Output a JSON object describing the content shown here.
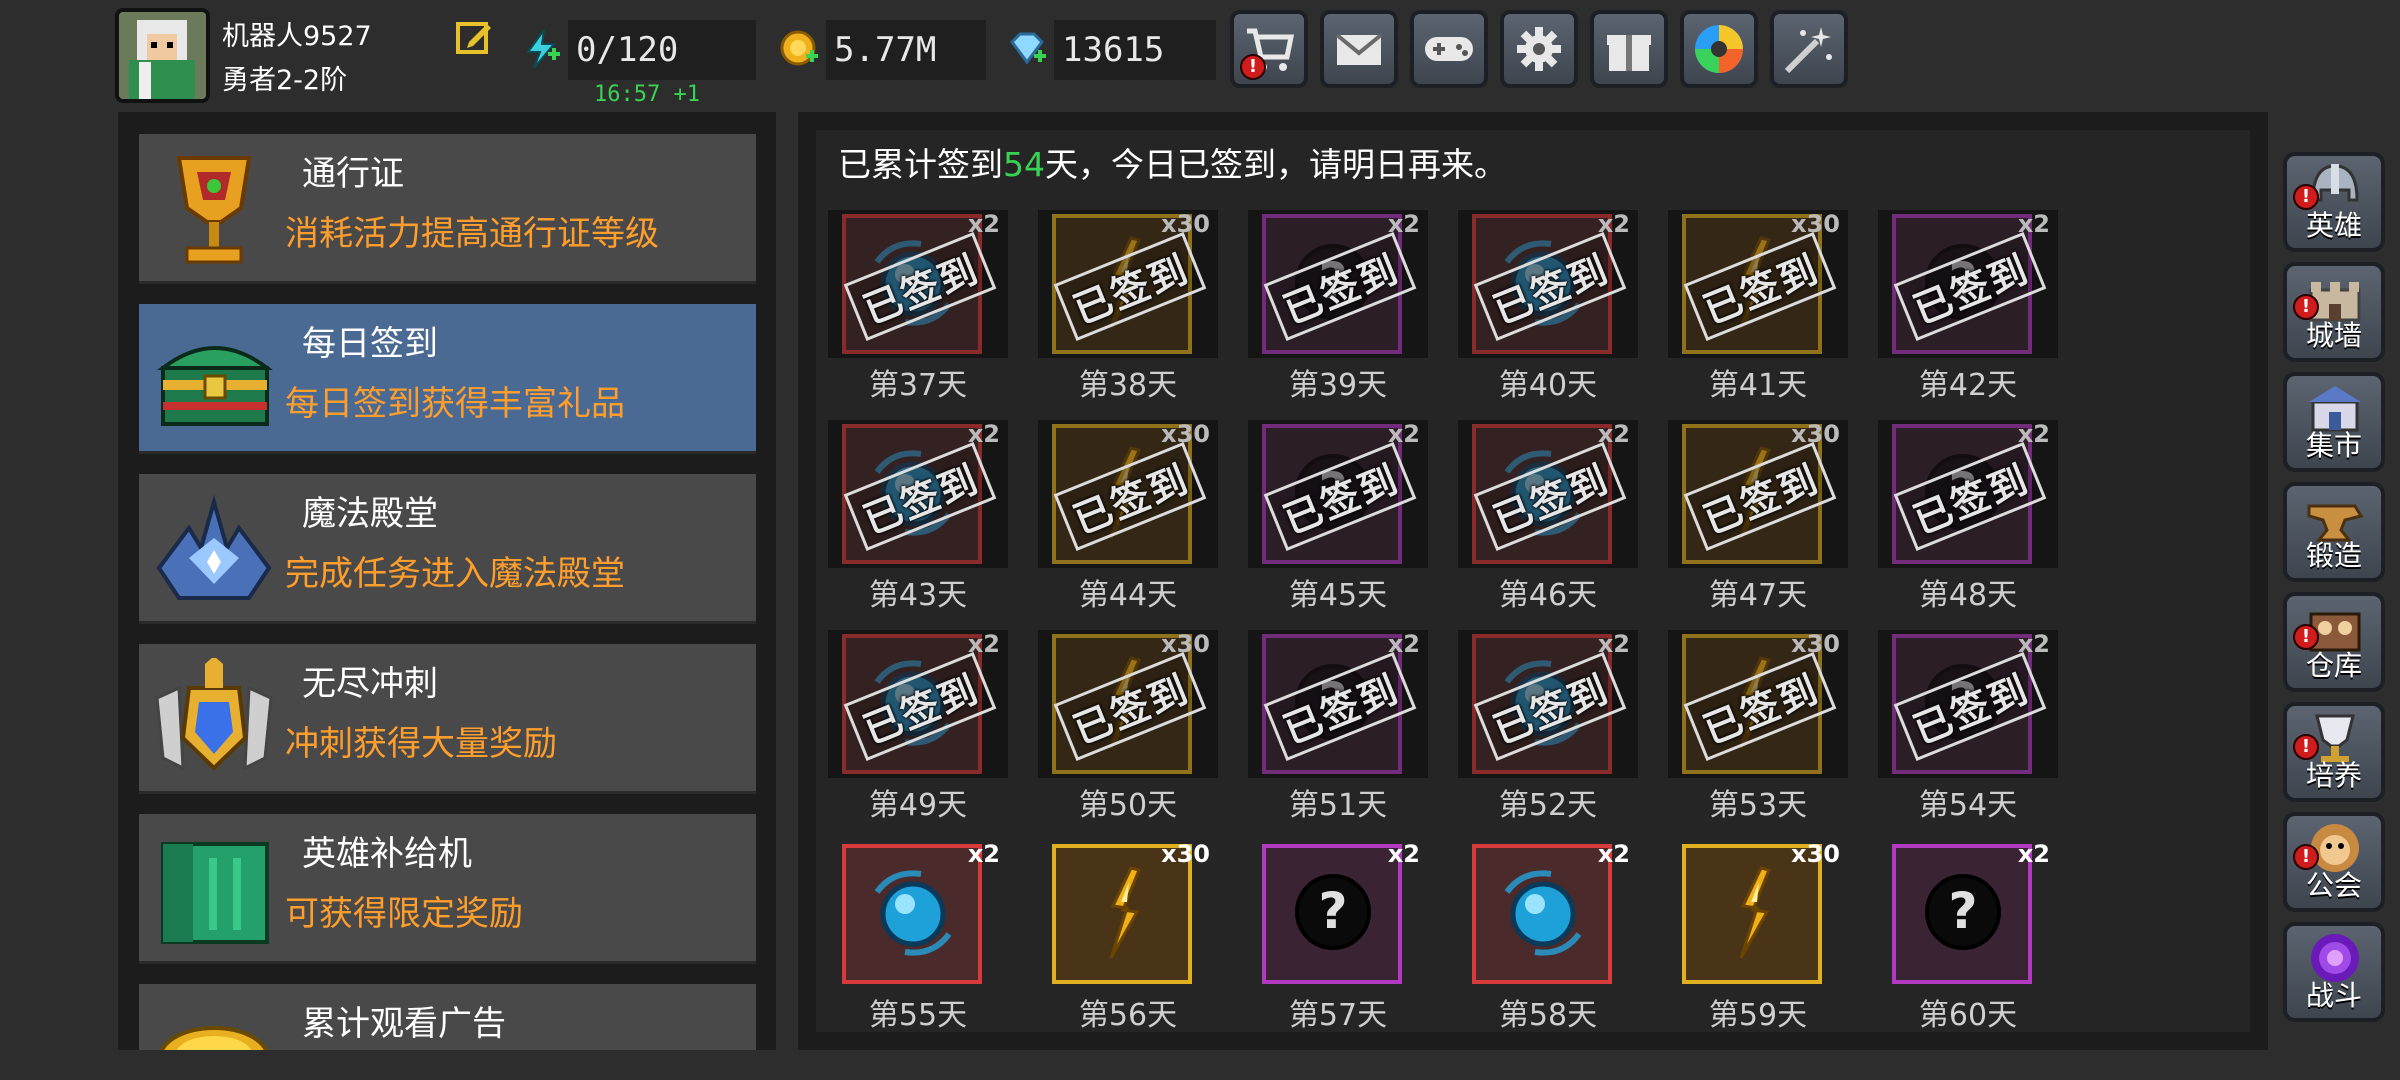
{
  "player": {
    "name": "机器人9527",
    "rank": "勇者2-2阶"
  },
  "stats": {
    "energy": "0/120",
    "energy_timer": "16:57 +1",
    "gold": "5.77M",
    "gems": "13615"
  },
  "top_buttons": [
    "shop-cart-icon",
    "mail-icon",
    "gamepad-icon",
    "gear-icon",
    "gift-icon",
    "color-wheel-icon",
    "fireworks-icon"
  ],
  "menu": [
    {
      "title": "通行证",
      "desc": "消耗活力提高通行证等级",
      "icon": "trophy-cup-icon"
    },
    {
      "title": "每日签到",
      "desc": "每日签到获得丰富礼品",
      "icon": "treasure-chest-icon"
    },
    {
      "title": "魔法殿堂",
      "desc": "完成任务进入魔法殿堂",
      "icon": "crystal-crown-icon"
    },
    {
      "title": "无尽冲刺",
      "desc": "冲刺获得大量奖励",
      "icon": "winged-gem-icon"
    },
    {
      "title": "英雄补给机",
      "desc": "可获得限定奖励",
      "icon": "green-crate-icon"
    },
    {
      "title": "累计观看广告",
      "desc": "",
      "icon": "gold-coins-icon"
    }
  ],
  "signin": {
    "prefix": "已累计签到",
    "days": "54",
    "suffix": "天，今日已签到，请明日再来。",
    "stamp_text": "已签到"
  },
  "rewards": [
    {
      "day": "第37天",
      "qty": "x2",
      "item": "blue-orb",
      "claimed": true
    },
    {
      "day": "第38天",
      "qty": "x30",
      "item": "gold-shard",
      "claimed": true
    },
    {
      "day": "第39天",
      "qty": "x2",
      "item": "mystery",
      "claimed": true
    },
    {
      "day": "第40天",
      "qty": "x2",
      "item": "blue-orb",
      "claimed": true
    },
    {
      "day": "第41天",
      "qty": "x30",
      "item": "gold-shard",
      "claimed": true
    },
    {
      "day": "第42天",
      "qty": "x2",
      "item": "mystery",
      "claimed": true
    },
    {
      "day": "第43天",
      "qty": "x2",
      "item": "blue-orb",
      "claimed": true
    },
    {
      "day": "第44天",
      "qty": "x30",
      "item": "gold-shard",
      "claimed": true
    },
    {
      "day": "第45天",
      "qty": "x2",
      "item": "mystery",
      "claimed": true
    },
    {
      "day": "第46天",
      "qty": "x2",
      "item": "blue-orb",
      "claimed": true
    },
    {
      "day": "第47天",
      "qty": "x30",
      "item": "gold-shard",
      "claimed": true
    },
    {
      "day": "第48天",
      "qty": "x2",
      "item": "mystery",
      "claimed": true
    },
    {
      "day": "第49天",
      "qty": "x2",
      "item": "blue-orb",
      "claimed": true
    },
    {
      "day": "第50天",
      "qty": "x30",
      "item": "gold-shard",
      "claimed": true
    },
    {
      "day": "第51天",
      "qty": "x2",
      "item": "mystery",
      "claimed": true
    },
    {
      "day": "第52天",
      "qty": "x2",
      "item": "blue-orb",
      "claimed": true
    },
    {
      "day": "第53天",
      "qty": "x30",
      "item": "gold-shard",
      "claimed": true
    },
    {
      "day": "第54天",
      "qty": "x2",
      "item": "mystery",
      "claimed": true
    },
    {
      "day": "第55天",
      "qty": "x2",
      "item": "blue-orb",
      "claimed": false
    },
    {
      "day": "第56天",
      "qty": "x30",
      "item": "gold-shard",
      "claimed": false
    },
    {
      "day": "第57天",
      "qty": "x2",
      "item": "mystery",
      "claimed": false
    },
    {
      "day": "第58天",
      "qty": "x2",
      "item": "blue-orb",
      "claimed": false
    },
    {
      "day": "第59天",
      "qty": "x30",
      "item": "gold-shard",
      "claimed": false
    },
    {
      "day": "第60天",
      "qty": "x2",
      "item": "mystery",
      "claimed": false
    }
  ],
  "nav": [
    {
      "label": "英雄",
      "icon": "helmet-icon",
      "alert": true
    },
    {
      "label": "城墙",
      "icon": "castle-wall-icon",
      "alert": true
    },
    {
      "label": "集市",
      "icon": "market-icon",
      "alert": false
    },
    {
      "label": "锻造",
      "icon": "anvil-icon",
      "alert": false
    },
    {
      "label": "仓库",
      "icon": "warehouse-icon",
      "alert": true
    },
    {
      "label": "培养",
      "icon": "goblet-icon",
      "alert": true
    },
    {
      "label": "公会",
      "icon": "guild-lion-icon",
      "alert": true
    },
    {
      "label": "战斗",
      "icon": "portal-icon",
      "alert": false
    }
  ],
  "colors": {
    "accent_orange": "#ff9e2c",
    "accent_green": "#39d353",
    "frame_red": "#d63a3a",
    "frame_gold": "#e0b020",
    "frame_purple": "#b23ac0",
    "active_menu": "#4b6a93"
  }
}
